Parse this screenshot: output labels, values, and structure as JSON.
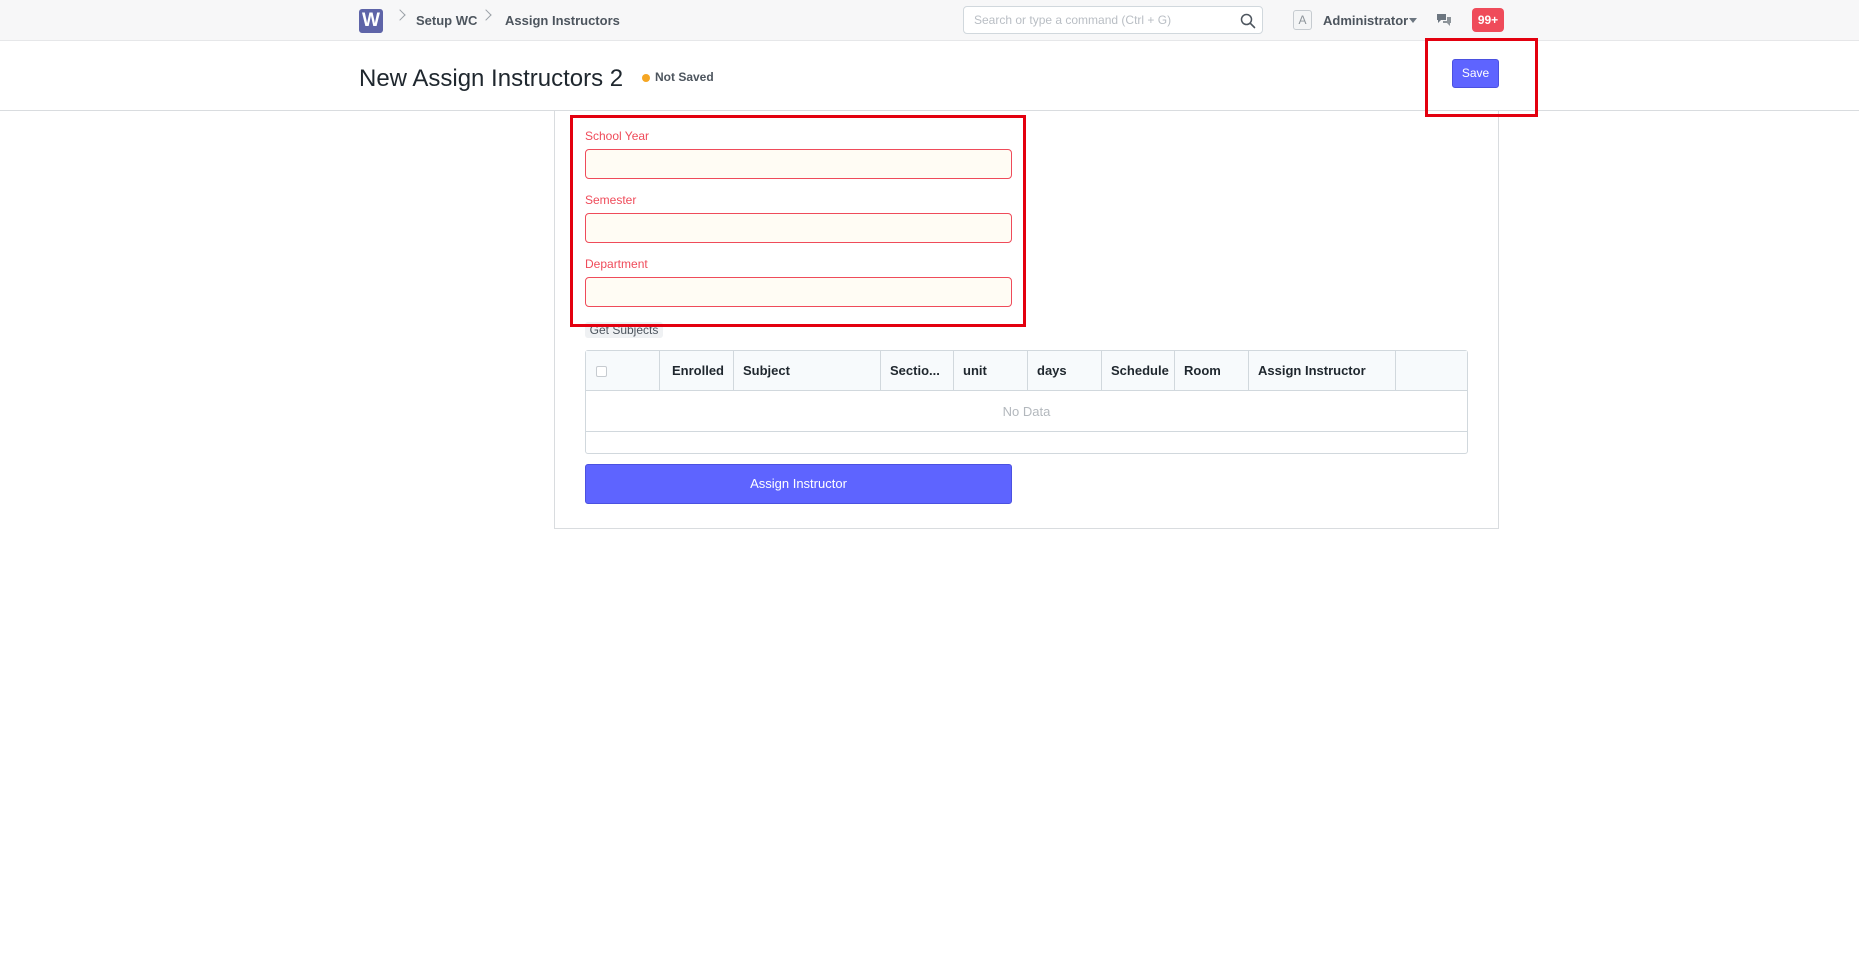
{
  "navbar": {
    "logo": "W",
    "breadcrumbs": [
      "Setup WC",
      "Assign Instructors"
    ],
    "search_placeholder": "Search or type a command (Ctrl + G)",
    "avatar_letter": "A",
    "user_label": "Administrator",
    "notification_count": "99+"
  },
  "page": {
    "title": "New Assign Instructors 2",
    "status": "Not Saved",
    "save_label": "Save"
  },
  "form": {
    "fields": [
      {
        "label": "School Year",
        "value": ""
      },
      {
        "label": "Semester",
        "value": ""
      },
      {
        "label": "Department",
        "value": ""
      }
    ],
    "get_subjects_label": "Get Subjects",
    "grid": {
      "columns": [
        "Enrolled",
        "Subject",
        "Sectio...",
        "unit",
        "days",
        "Schedule",
        "Room",
        "Assign Instructor"
      ],
      "empty_text": "No Data"
    },
    "assign_button_label": "Assign Instructor"
  },
  "colors": {
    "primary": "#5e64ff",
    "error": "#ef4b5a",
    "status_dot": "#f5a623",
    "annotation": "#e3000f"
  }
}
